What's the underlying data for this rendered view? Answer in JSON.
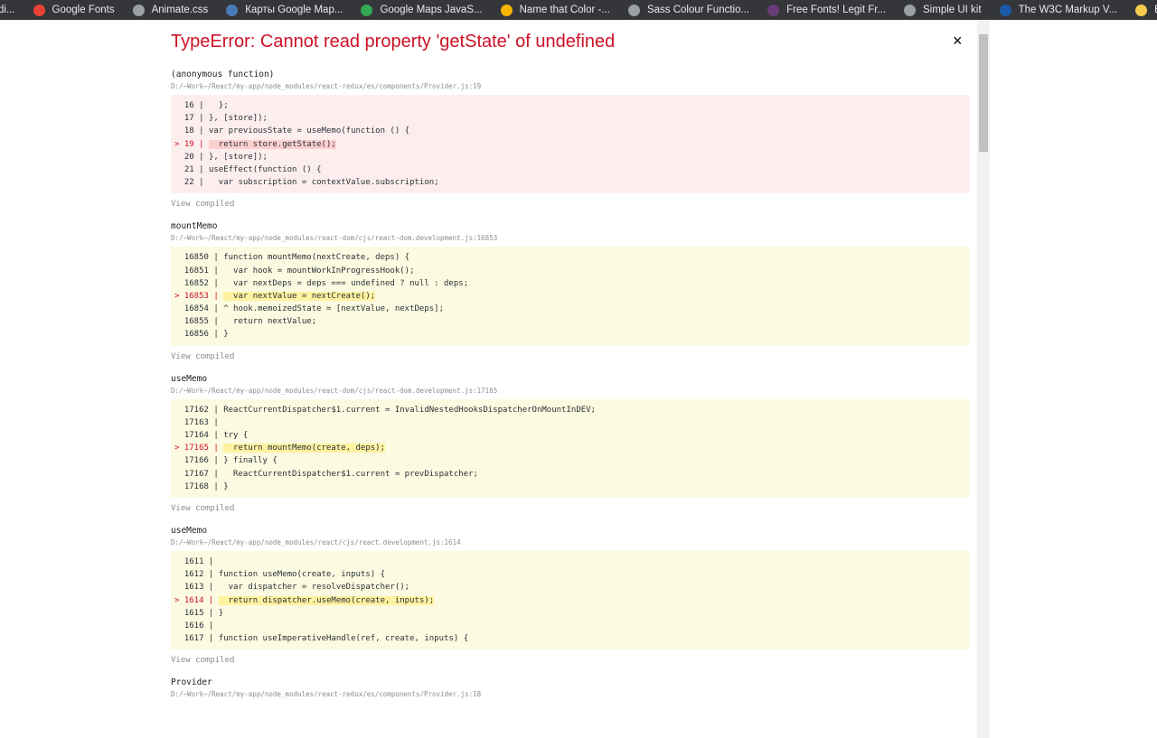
{
  "bookmarks": [
    {
      "label": "di...",
      "icon": "page-icon",
      "color": "#888"
    },
    {
      "label": "Google Fonts",
      "icon": "google-fonts-icon",
      "color": "#e94235"
    },
    {
      "label": "Animate.css",
      "icon": "globe-icon",
      "color": "#9aa0a6"
    },
    {
      "label": "Карты Google Map...",
      "icon": "maps-icon",
      "color": "#4a7ab8"
    },
    {
      "label": "Google Maps JavaS...",
      "icon": "maps-js-icon",
      "color": "#34a853"
    },
    {
      "label": "Name that Color -...",
      "icon": "color-icon",
      "color": "#f4b400"
    },
    {
      "label": "Sass Colour Functio...",
      "icon": "globe-icon",
      "color": "#9aa0a6"
    },
    {
      "label": "Free Fonts! Legit Fr...",
      "icon": "fonts-icon",
      "color": "#6a3d7a"
    },
    {
      "label": "Simple UI kit",
      "icon": "globe-icon",
      "color": "#9aa0a6"
    },
    {
      "label": "The W3C Markup V...",
      "icon": "w3c-icon",
      "color": "#1a5aa6"
    },
    {
      "label": "Buttons hover",
      "icon": "folder-icon",
      "color": "#f7cb4d"
    }
  ],
  "error": {
    "title": "TypeError: Cannot read property 'getState' of undefined",
    "close": "×"
  },
  "frames": [
    {
      "name": "(anonymous function)",
      "path": "D:/~Work~/React/my-app/node_modules/react-redux/es/components/Provider.js:19",
      "error": true,
      "view": "View compiled",
      "lines": [
        {
          "g": "  16 | ",
          "t": "  };"
        },
        {
          "g": "  17 | ",
          "t": "}, [store]);"
        },
        {
          "g": "  18 | ",
          "t": "var previousState = useMemo(function () {"
        },
        {
          "g": "> 19 | ",
          "t": "  return store.getState();",
          "hl": true
        },
        {
          "g": "  20 | ",
          "t": "}, [store]);"
        },
        {
          "g": "  21 | ",
          "t": "useEffect(function () {"
        },
        {
          "g": "  22 | ",
          "t": "  var subscription = contextValue.subscription;"
        }
      ]
    },
    {
      "name": "mountMemo",
      "path": "D:/~Work~/React/my-app/node_modules/react-dom/cjs/react-dom.development.js:16853",
      "view": "View compiled",
      "lines": [
        {
          "g": "  16850 | ",
          "t": "function mountMemo(nextCreate, deps) {"
        },
        {
          "g": "  16851 | ",
          "t": "  var hook = mountWorkInProgressHook();"
        },
        {
          "g": "  16852 | ",
          "t": "  var nextDeps = deps === undefined ? null : deps;"
        },
        {
          "g": "> 16853 | ",
          "t": "  var nextValue = nextCreate();",
          "hl": true
        },
        {
          "g": "  16854 | ",
          "t": "^ hook.memoizedState = [nextValue, nextDeps];"
        },
        {
          "g": "  16855 | ",
          "t": "  return nextValue;"
        },
        {
          "g": "  16856 | ",
          "t": "}"
        }
      ]
    },
    {
      "name": "useMemo",
      "path": "D:/~Work~/React/my-app/node_modules/react-dom/cjs/react-dom.development.js:17165",
      "view": "View compiled",
      "lines": [
        {
          "g": "  17162 | ",
          "t": "ReactCurrentDispatcher$1.current = InvalidNestedHooksDispatcherOnMountInDEV;"
        },
        {
          "g": "  17163 | ",
          "t": ""
        },
        {
          "g": "  17164 | ",
          "t": "try {"
        },
        {
          "g": "> 17165 | ",
          "t": "  return mountMemo(create, deps);",
          "hl": true
        },
        {
          "g": "  17166 | ",
          "t": "} finally {"
        },
        {
          "g": "  17167 | ",
          "t": "  ReactCurrentDispatcher$1.current = prevDispatcher;"
        },
        {
          "g": "  17168 | ",
          "t": "}"
        }
      ]
    },
    {
      "name": "useMemo",
      "path": "D:/~Work~/React/my-app/node_modules/react/cjs/react.development.js:1614",
      "view": "View compiled",
      "lines": [
        {
          "g": "  1611 | ",
          "t": ""
        },
        {
          "g": "  1612 | ",
          "t": "function useMemo(create, inputs) {"
        },
        {
          "g": "  1613 | ",
          "t": "  var dispatcher = resolveDispatcher();"
        },
        {
          "g": "> 1614 | ",
          "t": "  return dispatcher.useMemo(create, inputs);",
          "hl": true
        },
        {
          "g": "  1615 | ",
          "t": "}"
        },
        {
          "g": "  1616 | ",
          "t": ""
        },
        {
          "g": "  1617 | ",
          "t": "function useImperativeHandle(ref, create, inputs) {"
        }
      ]
    },
    {
      "name": "Provider",
      "path": "D:/~Work~/React/my-app/node_modules/react-redux/es/components/Provider.js:18"
    }
  ]
}
